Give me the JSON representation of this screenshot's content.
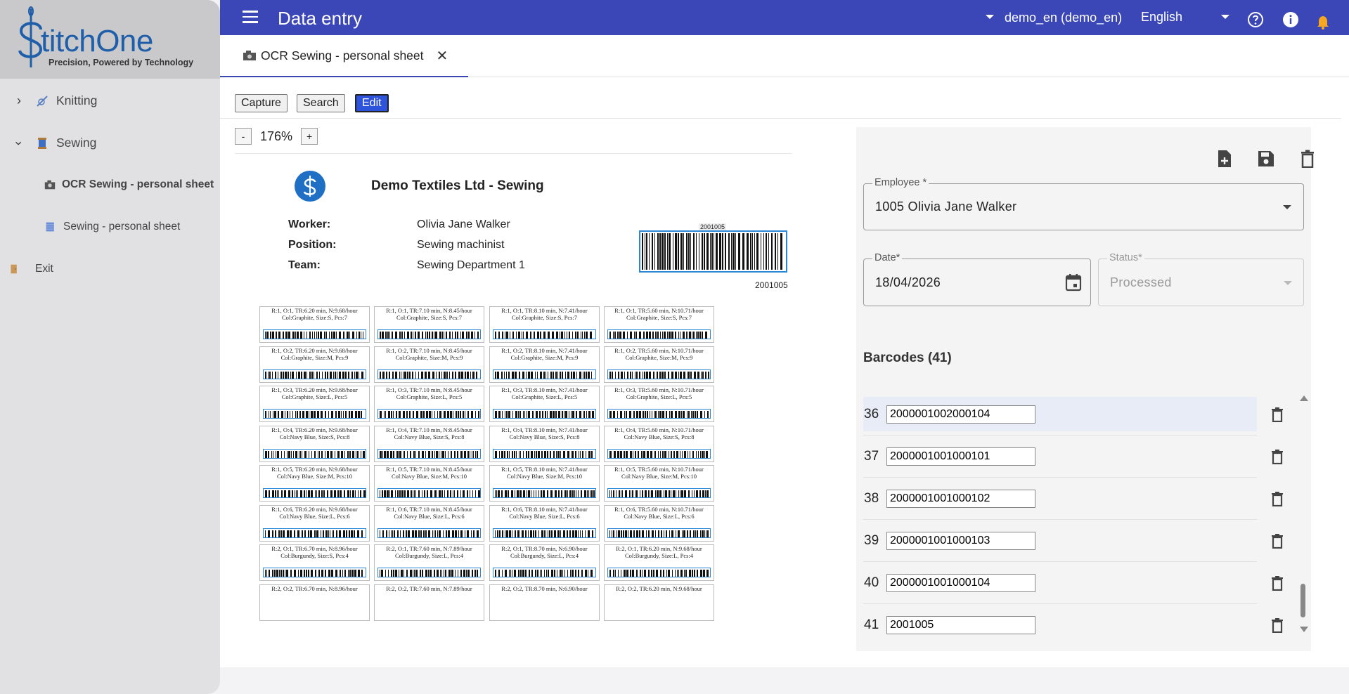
{
  "brand": {
    "name": "titchOne",
    "tagline": "Precision, Powered by Technology"
  },
  "sidebar": {
    "items": [
      {
        "label": "Knitting",
        "icon": "knitting-needle-icon",
        "expanded": false
      },
      {
        "label": "Sewing",
        "icon": "thread-spool-icon",
        "expanded": true
      },
      {
        "label": "OCR Sewing - personal sheet",
        "icon": "camera-icon",
        "active": true
      },
      {
        "label": "Sewing - personal sheet",
        "icon": "fabric-icon"
      },
      {
        "label": "Exit",
        "icon": "door-icon"
      }
    ]
  },
  "topbar": {
    "title": "Data entry",
    "company": "demo_en (demo_en)",
    "language": "English"
  },
  "tab": {
    "label": "OCR Sewing - personal sheet",
    "icon": "camera-icon"
  },
  "toolbar": {
    "capture": "Capture",
    "search": "Search",
    "edit": "Edit"
  },
  "zoom": {
    "minus": "-",
    "value": "176%",
    "plus": "+"
  },
  "document": {
    "company": "Demo Textiles Ltd - Sewing",
    "worker_label": "Worker:",
    "worker": "Olivia Jane Walker",
    "position_label": "Position:",
    "position": "Sewing machinist",
    "team_label": "Team:",
    "team": "Sewing Department 1",
    "barcode_top": "2001005",
    "barcode_bottom": "2001005",
    "labels": [
      [
        "R:1, O:1, TR:6.20 min, N:9.68/hour",
        "Col:Graphite, Size:S, Pcs:7",
        "2000001001000101"
      ],
      [
        "R:1, O:1, TR:7.10 min, N:8.45/hour",
        "Col:Graphite, Size:S, Pcs:7",
        "2000001001000102"
      ],
      [
        "R:1, O:1, TR:8.10 min, N:7.41/hour",
        "Col:Graphite, Size:S, Pcs:7",
        "2000001001000103"
      ],
      [
        "R:1, O:1, TR:5.60 min, N:10.71/hour",
        "Col:Graphite, Size:S, Pcs:7",
        "2000001001000104"
      ],
      [
        "R:1, O:2, TR:6.20 min, N:9.68/hour",
        "Col:Graphite, Size:M, Pcs:9",
        "2000001002000101"
      ],
      [
        "R:1, O:2, TR:7.10 min, N:8.45/hour",
        "Col:Graphite, Size:M, Pcs:9",
        "2000001002000102"
      ],
      [
        "R:1, O:2, TR:8.10 min, N:7.41/hour",
        "Col:Graphite, Size:M, Pcs:9",
        "2000001002000103"
      ],
      [
        "R:1, O:2, TR:5.60 min, N:10.71/hour",
        "Col:Graphite, Size:M, Pcs:9",
        "2000001002000104"
      ],
      [
        "R:1, O:3, TR:6.20 min, N:9.68/hour",
        "Col:Graphite, Size:L, Pcs:5",
        "2000001003000101"
      ],
      [
        "R:1, O:3, TR:7.10 min, N:8.45/hour",
        "Col:Graphite, Size:L, Pcs:5",
        "2000001003000102"
      ],
      [
        "R:1, O:3, TR:8.10 min, N:7.41/hour",
        "Col:Graphite, Size:L, Pcs:5",
        "2000001003000103"
      ],
      [
        "R:1, O:3, TR:5.60 min, N:10.71/hour",
        "Col:Graphite, Size:L, Pcs:5",
        "2000001003000104"
      ],
      [
        "R:1, O:4, TR:6.20 min, N:9.68/hour",
        "Col:Navy Blue, Size:S, Pcs:8",
        "2000001004000101"
      ],
      [
        "R:1, O:4, TR:7.10 min, N:8.45/hour",
        "Col:Navy Blue, Size:S, Pcs:8",
        "2000001004000102"
      ],
      [
        "R:1, O:4, TR:8.10 min, N:7.41/hour",
        "Col:Navy Blue, Size:S, Pcs:8",
        "2000001004000103"
      ],
      [
        "R:1, O:4, TR:5.60 min, N:10.71/hour",
        "Col:Navy Blue, Size:S, Pcs:8",
        "2000001004000104"
      ],
      [
        "R:1, O:5, TR:6.20 min, N:9.68/hour",
        "Col:Navy Blue, Size:M, Pcs:10",
        "2000001005000101"
      ],
      [
        "R:1, O:5, TR:7.10 min, N:8.45/hour",
        "Col:Navy Blue, Size:M, Pcs:10",
        "2000001005000102"
      ],
      [
        "R:1, O:5, TR:8.10 min, N:7.41/hour",
        "Col:Navy Blue, Size:M, Pcs:10",
        "2000001005000103"
      ],
      [
        "R:1, O:5, TR:5.60 min, N:10.71/hour",
        "Col:Navy Blue, Size:M, Pcs:10",
        "2000001005000104"
      ],
      [
        "R:1, O:6, TR:6.20 min, N:9.68/hour",
        "Col:Navy Blue, Size:L, Pcs:6",
        "2000001006000101"
      ],
      [
        "R:1, O:6, TR:7.10 min, N:8.45/hour",
        "Col:Navy Blue, Size:L, Pcs:6",
        "2000001006000102"
      ],
      [
        "R:1, O:6, TR:8.10 min, N:7.41/hour",
        "Col:Navy Blue, Size:L, Pcs:6",
        "2000001006000103"
      ],
      [
        "R:1, O:6, TR:5.60 min, N:10.71/hour",
        "Col:Navy Blue, Size:L, Pcs:6",
        "2000001006000104"
      ],
      [
        "R:2, O:1, TR:6.70 min, N:8.96/hour",
        "Col:Burgundy, Size:S, Pcs:4",
        "2000002001000101"
      ],
      [
        "R:2, O:1, TR:7.60 min, N:7.89/hour",
        "Col:Burgundy, Size:L, Pcs:4",
        "2000002001000102"
      ],
      [
        "R:2, O:1, TR:8.70 min, N:6.90/hour",
        "Col:Burgundy, Size:L, Pcs:4",
        "2000002001000103"
      ],
      [
        "R:2, O:1, TR:6.20 min, N:9.68/hour",
        "Col:Burgundy, Size:L, Pcs:4",
        "2000002001000104"
      ],
      [
        "R:2, O:2, TR:6.70 min, N:8.96/hour",
        "",
        ""
      ],
      [
        "R:2, O:2, TR:7.60 min, N:7.89/hour",
        "",
        ""
      ],
      [
        "R:2, O:2, TR:8.70 min, N:6.90/hour",
        "",
        ""
      ],
      [
        "R:2, O:2, TR:6.20 min, N:9.68/hour",
        "",
        ""
      ]
    ]
  },
  "form": {
    "employee_label": "Employee *",
    "employee": "1005 Olivia Jane Walker",
    "date_label": "Date*",
    "date": "18/04/2026",
    "status_label": "Status*",
    "status": "Processed",
    "barcodes_title": "Barcodes (41)",
    "barcodes": [
      {
        "n": "36",
        "value": "2000001002000104"
      },
      {
        "n": "37",
        "value": "2000001001000101"
      },
      {
        "n": "38",
        "value": "2000001001000102"
      },
      {
        "n": "39",
        "value": "2000001001000103"
      },
      {
        "n": "40",
        "value": "2000001001000104"
      },
      {
        "n": "41",
        "value": "2001005"
      }
    ]
  },
  "colors": {
    "topbar": "#3b47b7",
    "accent": "#2f54dc",
    "brand": "#1f5ea8"
  }
}
